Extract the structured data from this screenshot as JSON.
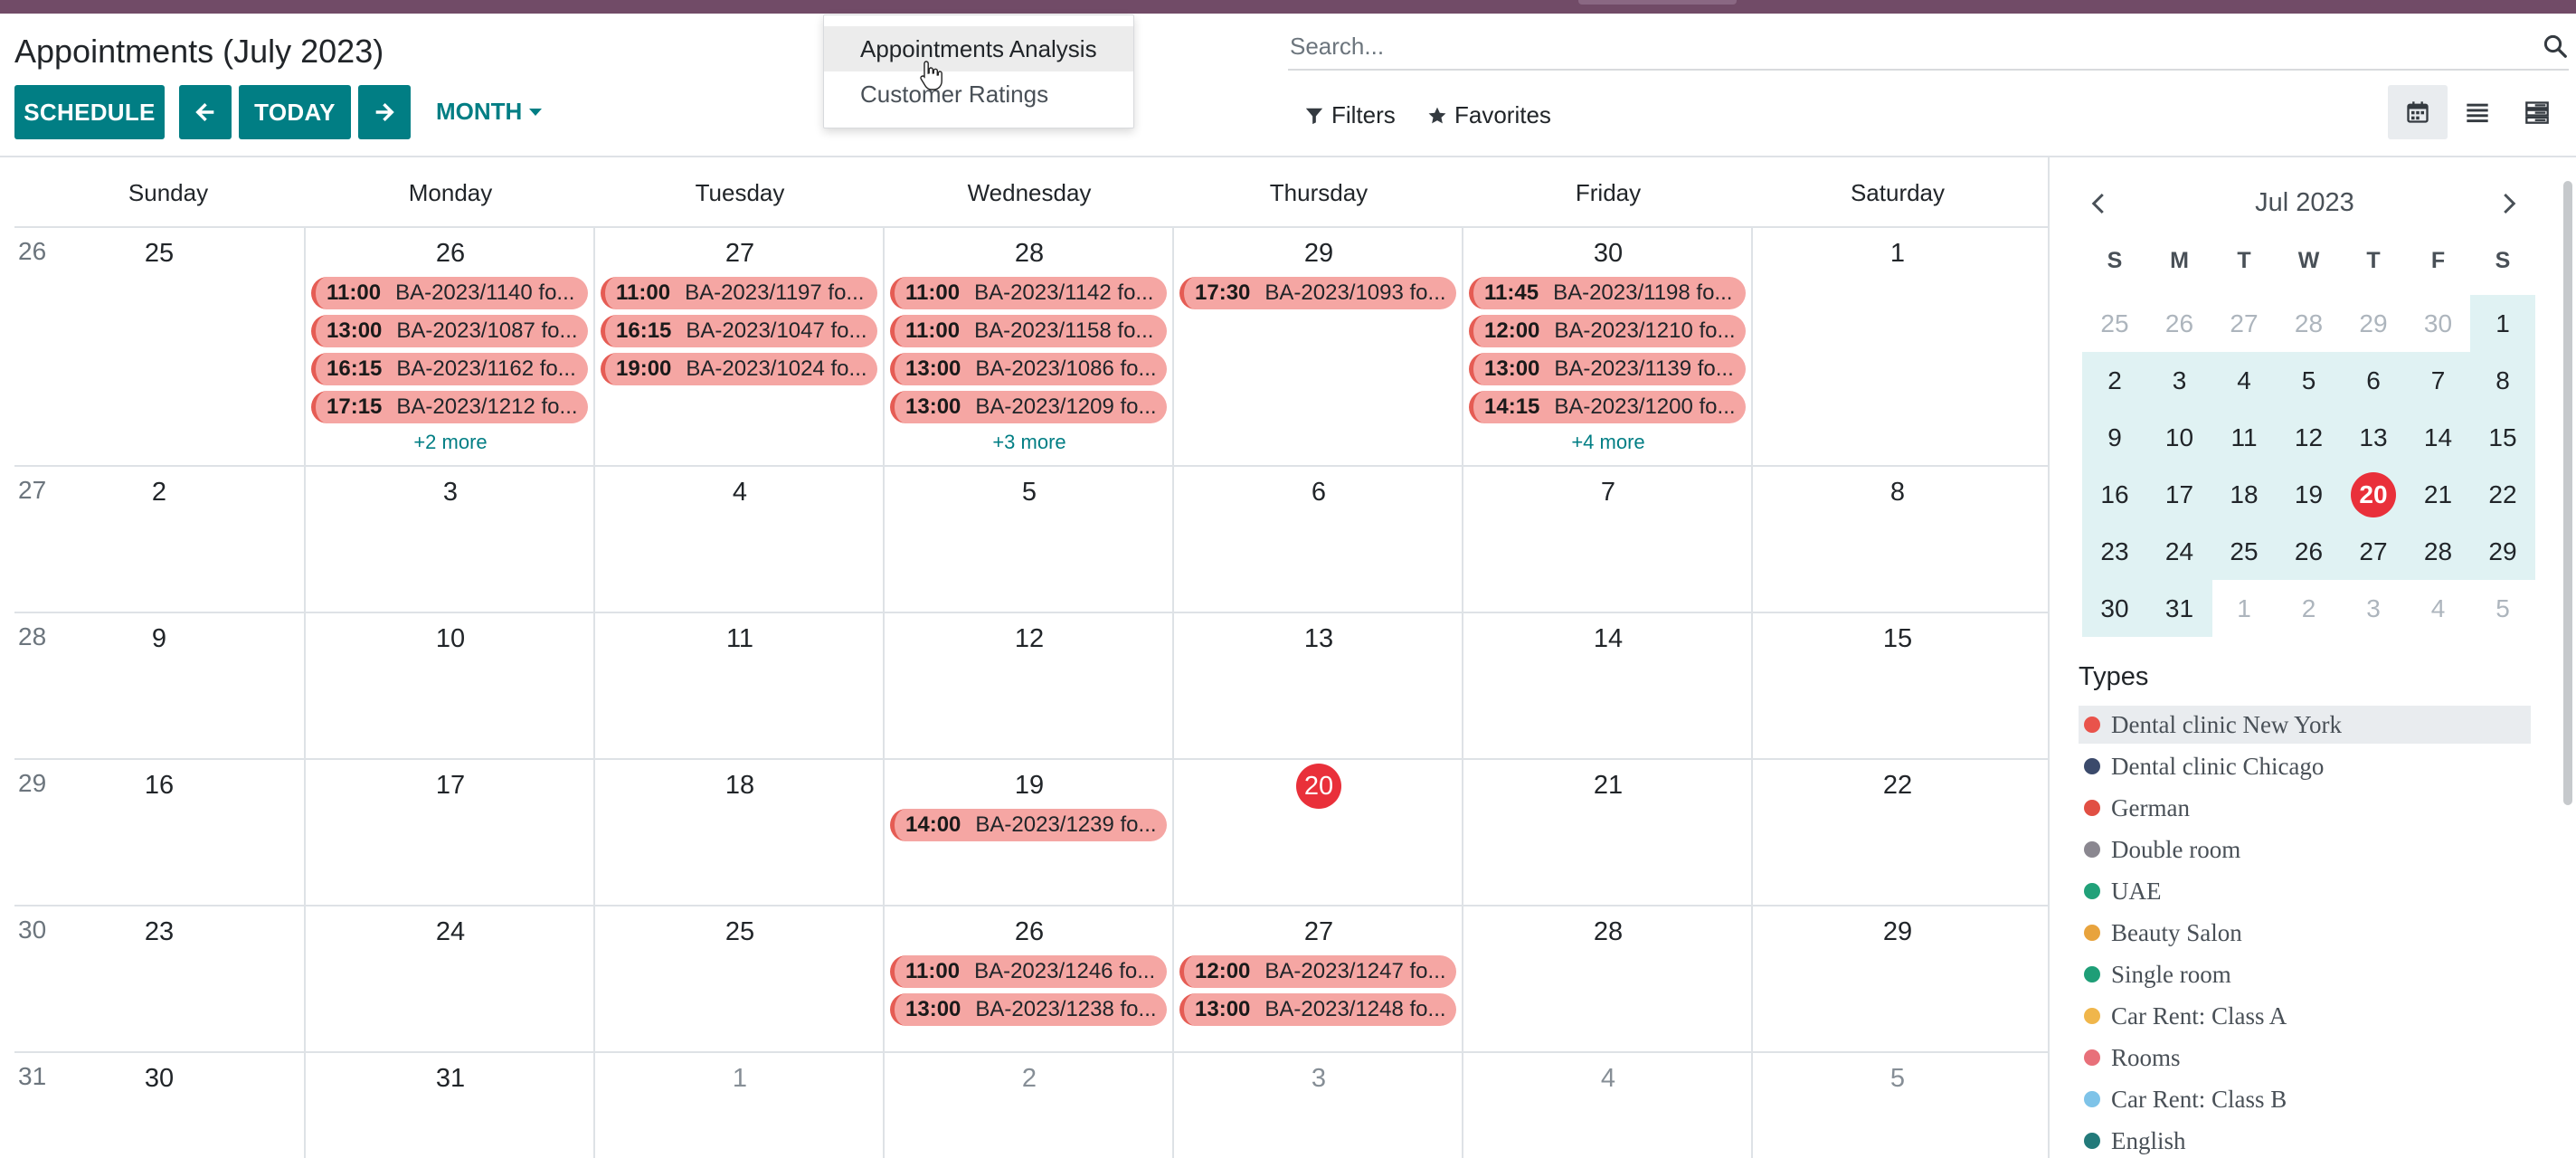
{
  "header": {
    "title": "Appointments (July 2023)",
    "schedule_label": "SCHEDULE",
    "today_label": "TODAY",
    "scale_label": "MONTH"
  },
  "report_menu": {
    "items": [
      "Appointments Analysis",
      "Customer Ratings"
    ]
  },
  "search": {
    "placeholder": "Search..."
  },
  "filters_label": "Filters",
  "favorites_label": "Favorites",
  "calendar": {
    "weekdays": [
      "Sunday",
      "Monday",
      "Tuesday",
      "Wednesday",
      "Thursday",
      "Friday",
      "Saturday"
    ],
    "weeks": [
      {
        "num": "26",
        "days": [
          "25",
          "26",
          "27",
          "28",
          "29",
          "30",
          "1"
        ]
      },
      {
        "num": "27",
        "days": [
          "2",
          "3",
          "4",
          "5",
          "6",
          "7",
          "8"
        ]
      },
      {
        "num": "28",
        "days": [
          "9",
          "10",
          "11",
          "12",
          "13",
          "14",
          "15"
        ]
      },
      {
        "num": "29",
        "days": [
          "16",
          "17",
          "18",
          "19",
          "20",
          "21",
          "22"
        ]
      },
      {
        "num": "30",
        "days": [
          "23",
          "24",
          "25",
          "26",
          "27",
          "28",
          "29"
        ]
      },
      {
        "num": "31",
        "days": [
          "30",
          "31",
          "1",
          "2",
          "3",
          "4",
          "5"
        ]
      }
    ],
    "today": "20",
    "events": [
      {
        "week": 0,
        "day": 1,
        "slot": 0,
        "time": "11:00",
        "title": "BA-2023/1140 fo..."
      },
      {
        "week": 0,
        "day": 1,
        "slot": 1,
        "time": "13:00",
        "title": "BA-2023/1087 fo..."
      },
      {
        "week": 0,
        "day": 1,
        "slot": 2,
        "time": "16:15",
        "title": "BA-2023/1162 fo..."
      },
      {
        "week": 0,
        "day": 1,
        "slot": 3,
        "time": "17:15",
        "title": "BA-2023/1212 fo..."
      },
      {
        "week": 0,
        "day": 2,
        "slot": 0,
        "time": "11:00",
        "title": "BA-2023/1197 fo..."
      },
      {
        "week": 0,
        "day": 2,
        "slot": 1,
        "time": "16:15",
        "title": "BA-2023/1047 fo..."
      },
      {
        "week": 0,
        "day": 2,
        "slot": 2,
        "time": "19:00",
        "title": "BA-2023/1024 fo..."
      },
      {
        "week": 0,
        "day": 3,
        "slot": 0,
        "time": "11:00",
        "title": "BA-2023/1142 fo..."
      },
      {
        "week": 0,
        "day": 3,
        "slot": 1,
        "time": "11:00",
        "title": "BA-2023/1158 fo..."
      },
      {
        "week": 0,
        "day": 3,
        "slot": 2,
        "time": "13:00",
        "title": "BA-2023/1086 fo..."
      },
      {
        "week": 0,
        "day": 3,
        "slot": 3,
        "time": "13:00",
        "title": "BA-2023/1209 fo..."
      },
      {
        "week": 0,
        "day": 4,
        "slot": 0,
        "time": "17:30",
        "title": "BA-2023/1093 fo..."
      },
      {
        "week": 0,
        "day": 5,
        "slot": 0,
        "time": "11:45",
        "title": "BA-2023/1198 fo..."
      },
      {
        "week": 0,
        "day": 5,
        "slot": 1,
        "time": "12:00",
        "title": "BA-2023/1210 fo..."
      },
      {
        "week": 0,
        "day": 5,
        "slot": 2,
        "time": "13:00",
        "title": "BA-2023/1139 fo..."
      },
      {
        "week": 0,
        "day": 5,
        "slot": 3,
        "time": "14:15",
        "title": "BA-2023/1200 fo..."
      },
      {
        "week": 3,
        "day": 3,
        "slot": 0,
        "time": "14:00",
        "title": "BA-2023/1239 fo..."
      },
      {
        "week": 4,
        "day": 3,
        "slot": 0,
        "time": "11:00",
        "title": "BA-2023/1246 fo..."
      },
      {
        "week": 4,
        "day": 3,
        "slot": 1,
        "time": "13:00",
        "title": "BA-2023/1238 fo..."
      },
      {
        "week": 4,
        "day": 4,
        "slot": 0,
        "time": "12:00",
        "title": "BA-2023/1247 fo..."
      },
      {
        "week": 4,
        "day": 4,
        "slot": 1,
        "time": "13:00",
        "title": "BA-2023/1248 fo..."
      }
    ],
    "more": [
      {
        "week": 0,
        "day": 1,
        "label": "+2 more"
      },
      {
        "week": 0,
        "day": 3,
        "label": "+3 more"
      },
      {
        "week": 0,
        "day": 5,
        "label": "+4 more"
      }
    ]
  },
  "mini_calendar": {
    "title": "Jul 2023",
    "dow": [
      "S",
      "M",
      "T",
      "W",
      "T",
      "F",
      "S"
    ],
    "rows": [
      [
        "25",
        "26",
        "27",
        "28",
        "29",
        "30",
        "1"
      ],
      [
        "2",
        "3",
        "4",
        "5",
        "6",
        "7",
        "8"
      ],
      [
        "9",
        "10",
        "11",
        "12",
        "13",
        "14",
        "15"
      ],
      [
        "16",
        "17",
        "18",
        "19",
        "20",
        "21",
        "22"
      ],
      [
        "23",
        "24",
        "25",
        "26",
        "27",
        "28",
        "29"
      ],
      [
        "30",
        "31",
        "1",
        "2",
        "3",
        "4",
        "5"
      ]
    ],
    "today": "20"
  },
  "types": {
    "title": "Types",
    "items": [
      {
        "label": "Dental clinic New York",
        "color": "#e9534b"
      },
      {
        "label": "Dental clinic Chicago",
        "color": "#3b4a6b"
      },
      {
        "label": "German",
        "color": "#e14f44"
      },
      {
        "label": "Double room",
        "color": "#8a8790"
      },
      {
        "label": "UAE",
        "color": "#21a179"
      },
      {
        "label": "Beauty Salon",
        "color": "#e8a33d"
      },
      {
        "label": "Single room",
        "color": "#1e9e77"
      },
      {
        "label": "Car Rent: Class A",
        "color": "#f0b64b"
      },
      {
        "label": "Rooms",
        "color": "#e8707a"
      },
      {
        "label": "Car Rent: Class B",
        "color": "#7ec3e8"
      },
      {
        "label": "English",
        "color": "#237a7a"
      }
    ]
  },
  "colors": {
    "accent": "#017e84",
    "brand_bar": "#714B67",
    "event_bg": "#f5a6a3",
    "event_border": "#e55c54",
    "today": "#e9303a"
  }
}
